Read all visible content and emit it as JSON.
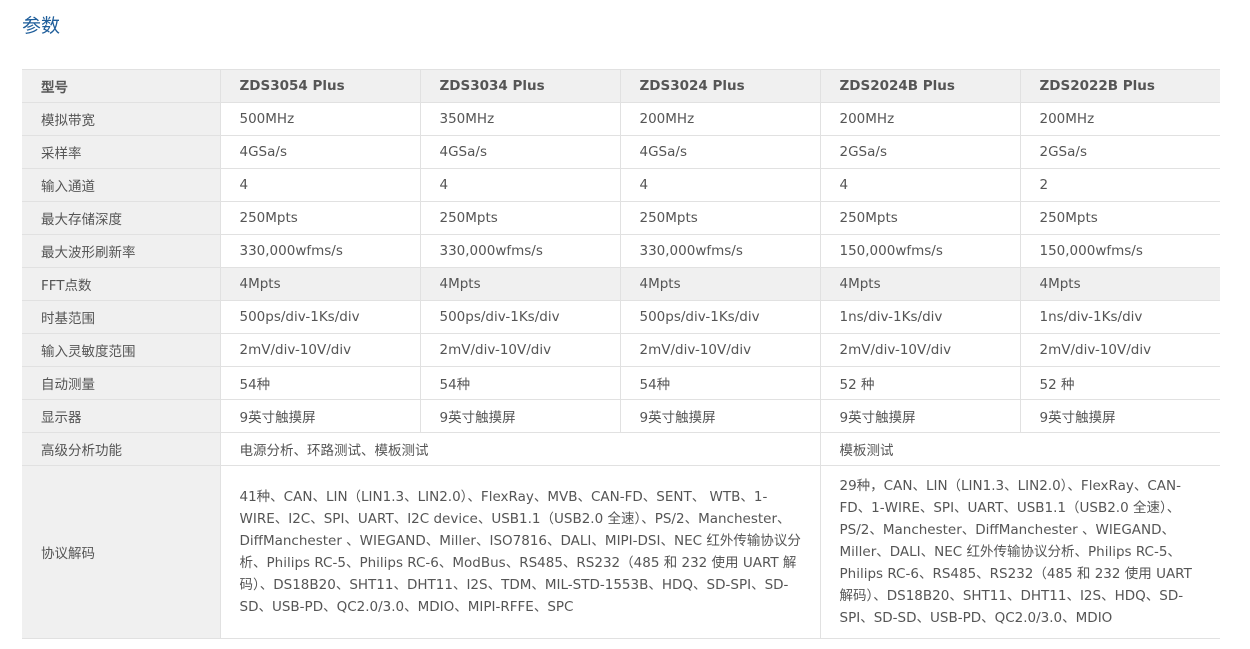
{
  "title": "参数",
  "table": {
    "headers": [
      "型号",
      "ZDS3054 Plus",
      "ZDS3034 Plus",
      "ZDS3024 Plus",
      "ZDS2024B Plus",
      "ZDS2022B Plus"
    ],
    "rows": [
      [
        "模拟带宽",
        "500MHz",
        "350MHz",
        "200MHz",
        "200MHz",
        "200MHz"
      ],
      [
        "采样率",
        "4GSa/s",
        "4GSa/s",
        "4GSa/s",
        "2GSa/s",
        "2GSa/s"
      ],
      [
        "输入通道",
        "4",
        "4",
        "4",
        "4",
        "2"
      ],
      [
        "最大存储深度",
        "250Mpts",
        "250Mpts",
        "250Mpts",
        "250Mpts",
        "250Mpts"
      ],
      [
        "最大波形刷新率",
        "330,000wfms/s",
        "330,000wfms/s",
        "330,000wfms/s",
        "150,000wfms/s",
        "150,000wfms/s"
      ],
      [
        "FFT点数",
        "4Mpts",
        "4Mpts",
        "4Mpts",
        "4Mpts",
        "4Mpts"
      ],
      [
        "时基范围",
        "500ps/div-1Ks/div",
        "500ps/div-1Ks/div",
        "500ps/div-1Ks/div",
        "1ns/div-1Ks/div",
        "1ns/div-1Ks/div"
      ],
      [
        "输入灵敏度范围",
        "2mV/div-10V/div",
        "2mV/div-10V/div",
        "2mV/div-10V/div",
        "2mV/div-10V/div",
        "2mV/div-10V/div"
      ],
      [
        "自动测量",
        "54种",
        "54种",
        "54种",
        "52 种",
        "52 种"
      ],
      [
        "显示器",
        "9英寸触摸屏",
        "9英寸触摸屏",
        "9英寸触摸屏",
        "9英寸触摸屏",
        "9英寸触摸屏"
      ]
    ],
    "analysis": {
      "label": "高级分析功能",
      "zds3000": "电源分析、环路测试、模板测试",
      "zds2000": "模板测试"
    },
    "decode": {
      "label": "协议解码",
      "zds3000": "41种、CAN、LIN（LIN1.3、LIN2.0）、FlexRay、MVB、CAN-FD、SENT、 WTB、1-WIRE、I2C、SPI、UART、I2C device、USB1.1（USB2.0 全速）、PS/2、Manchester、DiffManchester 、WIEGAND、Miller、ISO7816、DALI、MIPI-DSI、NEC 红外传输协议分析、Philips RC-5、Philips RC-6、ModBus、RS485、RS232（485 和 232 使用 UART 解码）、DS18B20、SHT11、DHT11、I2S、TDM、MIL-STD-1553B、HDQ、SD-SPI、SD-SD、USB-PD、QC2.0/3.0、MDIO、MIPI-RFFE、SPC",
      "zds2000": "29种，CAN、LIN（LIN1.3、LIN2.0）、FlexRay、CAN-FD、1-WIRE、SPI、UART、USB1.1（USB2.0 全速）、PS/2、Manchester、DiffManchester 、WIEGAND、Miller、DALI、NEC 红外传输协议分析、Philips RC-5、Philips RC-6、RS485、RS232（485 和 232 使用 UART 解码）、DS18B20、SHT11、DHT11、I2S、HDQ、SD-SPI、SD-SD、USB-PD、QC2.0/3.0、MDIO"
    }
  }
}
